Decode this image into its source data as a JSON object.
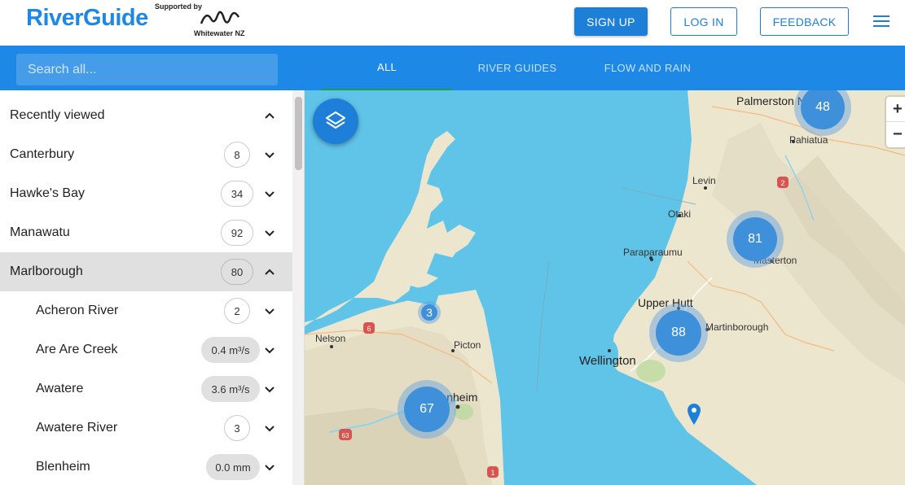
{
  "header": {
    "logo": "RiverGuide",
    "sponsor_top": "Supported by",
    "sponsor_bottom": "Whitewater NZ",
    "signup": "SIGN UP",
    "login": "LOG IN",
    "feedback": "FEEDBACK"
  },
  "nav": {
    "search_placeholder": "Search all...",
    "tabs": [
      "ALL",
      "RIVER GUIDES",
      "FLOW AND RAIN"
    ]
  },
  "sidebar": {
    "items": [
      {
        "label": "Recently viewed",
        "badge": "",
        "expanded": true
      },
      {
        "label": "Canterbury",
        "badge": "8"
      },
      {
        "label": "Hawke's Bay",
        "badge": "34"
      },
      {
        "label": "Manawatu",
        "badge": "92"
      },
      {
        "label": "Marlborough",
        "badge": "80",
        "expanded": true,
        "active": true
      },
      {
        "label": "Acheron River",
        "badge": "2"
      },
      {
        "label": "Are Are Creek",
        "badge": "0.4 m³/s"
      },
      {
        "label": "Awatere",
        "badge": "3.6 m³/s"
      },
      {
        "label": "Awatere River",
        "badge": "3"
      },
      {
        "label": "Blenheim",
        "badge": "0.0 mm"
      }
    ]
  },
  "map": {
    "places": [
      "Palmerston North",
      "Pahiatua",
      "Levin",
      "Otaki",
      "Paraparaumu",
      "Masterton",
      "Upper Hutt",
      "Martinborough",
      "Wellington",
      "Nelson",
      "Picton",
      "Blenheim"
    ],
    "road_shields": [
      "2",
      "6",
      "63",
      "1"
    ],
    "clusters": [
      "48",
      "81",
      "88",
      "3",
      "67"
    ],
    "zoom_in": "+",
    "zoom_out": "−"
  },
  "colors": {
    "accent": "#1d88e5",
    "button": "#1d7fd8",
    "water": "#5fc4e8",
    "land": "#f0ebd8",
    "cluster": "#3f90da",
    "tab_indicator": "#1b9e4b"
  },
  "icons": {
    "layers": "layers-icon",
    "menu": "hamburger-menu-icon",
    "chevron_up": "chevron-up-icon",
    "chevron_down": "chevron-down-icon",
    "pin": "map-pin-icon"
  }
}
